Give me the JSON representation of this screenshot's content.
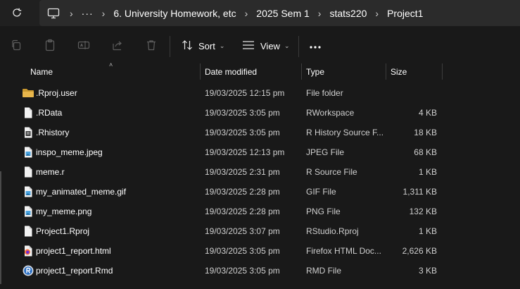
{
  "addressbar": {
    "overflow": "···",
    "separator": "›",
    "crumbs": [
      "6. University Homework, etc",
      "2025 Sem 1",
      "stats220",
      "Project1"
    ]
  },
  "toolbar": {
    "sort_label": "Sort",
    "view_label": "View",
    "chevron": "⌵",
    "more": "•••"
  },
  "columns": {
    "name": "Name",
    "date": "Date modified",
    "type": "Type",
    "size": "Size",
    "sort_indicator": "˄"
  },
  "files": [
    {
      "name": ".Rproj.user",
      "date": "19/03/2025 12:15 pm",
      "type": "File folder",
      "size": "",
      "icon": "folder-icon"
    },
    {
      "name": ".RData",
      "date": "19/03/2025 3:05 pm",
      "type": "RWorkspace",
      "size": "4 KB",
      "icon": "file-icon"
    },
    {
      "name": ".Rhistory",
      "date": "19/03/2025 3:05 pm",
      "type": "R History Source F...",
      "size": "18 KB",
      "icon": "text-file-icon"
    },
    {
      "name": "inspo_meme.jpeg",
      "date": "19/03/2025 12:13 pm",
      "type": "JPEG File",
      "size": "68 KB",
      "icon": "image-file-icon"
    },
    {
      "name": "meme.r",
      "date": "19/03/2025 2:31 pm",
      "type": "R Source File",
      "size": "1 KB",
      "icon": "file-icon"
    },
    {
      "name": "my_animated_meme.gif",
      "date": "19/03/2025 2:28 pm",
      "type": "GIF File",
      "size": "1,311 KB",
      "icon": "image-file-icon"
    },
    {
      "name": "my_meme.png",
      "date": "19/03/2025 2:28 pm",
      "type": "PNG File",
      "size": "132 KB",
      "icon": "image-file-icon"
    },
    {
      "name": "Project1.Rproj",
      "date": "19/03/2025 3:07 pm",
      "type": "RStudio.Rproj",
      "size": "1 KB",
      "icon": "file-icon"
    },
    {
      "name": "project1_report.html",
      "date": "19/03/2025 3:05 pm",
      "type": "Firefox HTML Doc...",
      "size": "2,626 KB",
      "icon": "firefox-icon"
    },
    {
      "name": "project1_report.Rmd",
      "date": "19/03/2025 3:05 pm",
      "type": "RMD File",
      "size": "3 KB",
      "icon": "r-logo-icon"
    }
  ],
  "colors": {
    "background": "#191919",
    "folder": "#e8b64b",
    "image_accent": "#4aa3df",
    "r_blue": "#276dc3"
  }
}
